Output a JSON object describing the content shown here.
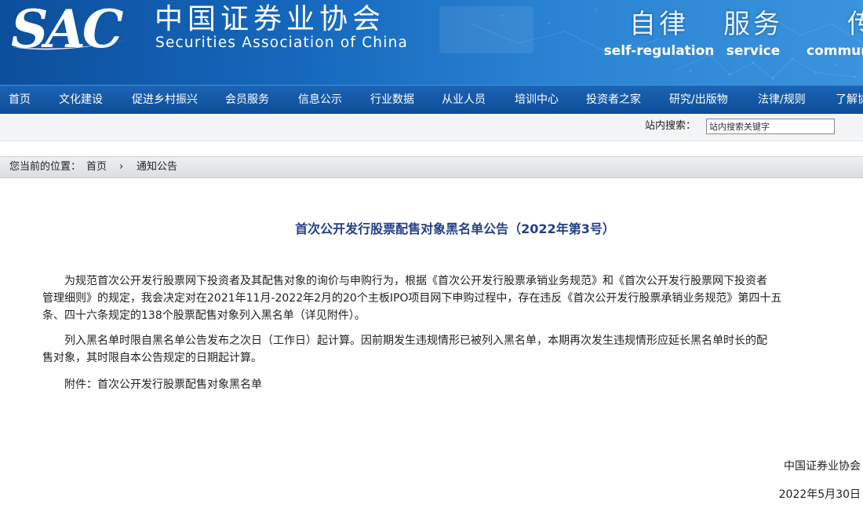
{
  "header": {
    "logo_text": "SAC",
    "org_name_cn": "中国证券业协会",
    "org_name_en": "Securities Association of China",
    "slogans": [
      {
        "zh": "自律",
        "en": "self-regulation"
      },
      {
        "zh": "服务",
        "en": "service"
      },
      {
        "zh": "传导",
        "en": "communication"
      }
    ]
  },
  "nav": {
    "items": [
      "首页",
      "文化建设",
      "促进乡村振兴",
      "会员服务",
      "信息公示",
      "行业数据",
      "从业人员",
      "培训中心",
      "投资者之家",
      "研究/出版物",
      "法律/规则",
      "了解协会"
    ]
  },
  "search": {
    "label": "站内搜索：",
    "value": "站内搜索关键字"
  },
  "breadcrumb": {
    "prefix": "您当前的位置：",
    "home": "首页",
    "separator": "›",
    "current": "通知公告"
  },
  "article": {
    "title": "首次公开发行股票配售对象黑名单公告（2022年第3号）",
    "paragraphs": [
      [
        "　　为规范首次公开发行股票网下投资者及其配售对象的询价与申购行为，根据《首次公开发行股票承销业务规范》和《首次公开发行股票网下投资者",
        "管理细则》的规定，我会决定对在2021年11月-2022年2月的20个主板IPO项目网下申购过程中，存在违反《首次公开发行股票承销业务规范》第四十五",
        "条、四十六条规定的138个股票配售对象列入黑名单（详见附件）。"
      ],
      [
        "　　列入黑名单时限自黑名单公告发布之次日（工作日）起计算。因前期发生违规情形已被列入黑名单，本期再次发生违规情形应延长黑名单时长的配",
        "售对象，其时限自本公告规定的日期起计算。"
      ],
      [
        "　　附件：首次公开发行股票配售对象黑名单"
      ]
    ],
    "signature": "中国证券业协会",
    "date": "2022年5月30日"
  }
}
